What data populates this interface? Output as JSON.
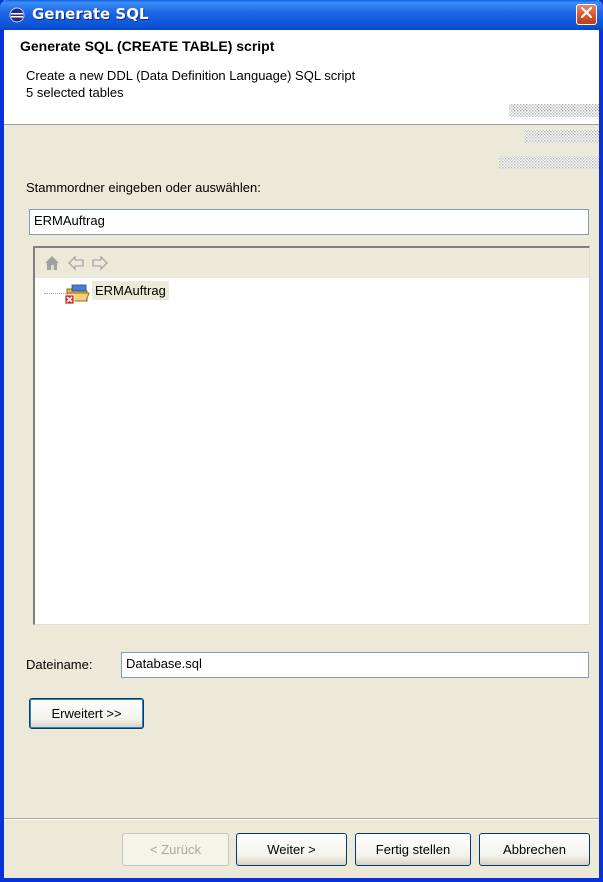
{
  "window": {
    "title": "Generate SQL",
    "close_icon": "close-icon"
  },
  "header": {
    "title": "Generate SQL (CREATE TABLE) script",
    "description_line1": "Create a new DDL (Data Definition Language) SQL script",
    "description_line2": "5 selected tables"
  },
  "folder": {
    "label": "Stammordner eingeben oder auswählen:",
    "value": "ERMAuftrag"
  },
  "tree": {
    "toolbar": [
      "home-icon",
      "back-arrow-icon",
      "forward-arrow-icon"
    ],
    "items": [
      {
        "label": "ERMAuftrag",
        "icon": "project-folder-icon"
      }
    ]
  },
  "filename": {
    "label": "Dateiname:",
    "value": "Database.sql"
  },
  "buttons": {
    "advanced": "Erweitert >>",
    "back": "< Zurück",
    "next": "Weiter >",
    "finish": "Fertig stellen",
    "cancel": "Abbrechen"
  },
  "colors": {
    "titlebar": "#0a5ee5",
    "dialog_bg": "#ece9d8",
    "close": "#d65229"
  }
}
